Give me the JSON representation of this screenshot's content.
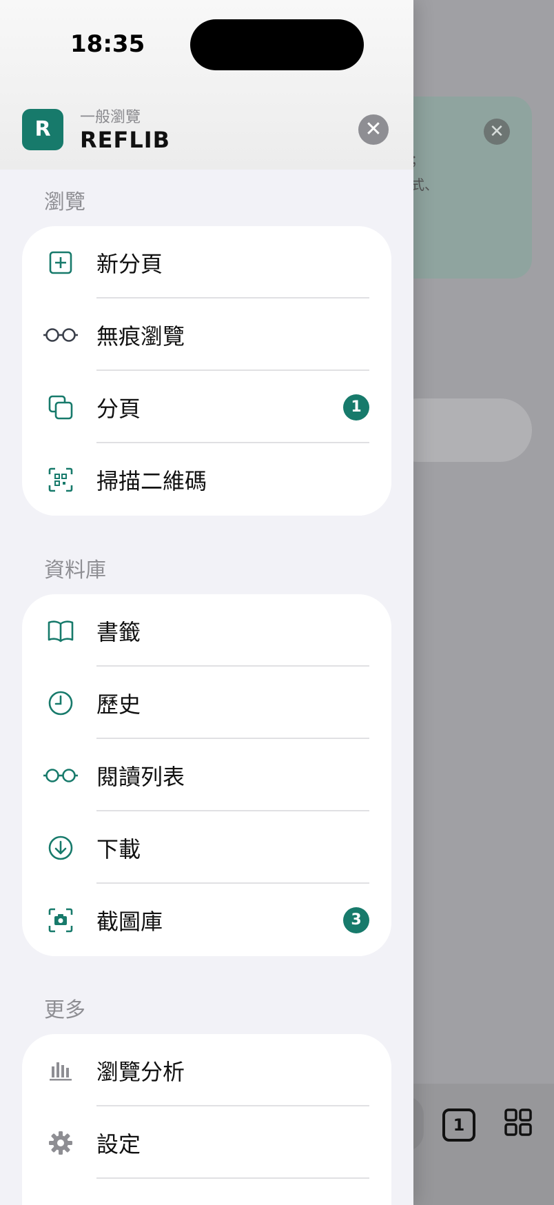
{
  "status_bar": {
    "time": "18:35"
  },
  "header": {
    "app_logo_letter": "R",
    "subtitle": "一般瀏覽",
    "title": "REFLIB",
    "close_icon": "close-icon"
  },
  "sections": [
    {
      "title": "瀏覽",
      "items": [
        {
          "label": "新分頁",
          "icon": "plus-square-icon"
        },
        {
          "label": "無痕瀏覽",
          "icon": "glasses-icon"
        },
        {
          "label": "分頁",
          "icon": "tabs-icon",
          "badge": "1"
        },
        {
          "label": "掃描二維碼",
          "icon": "qr-scan-icon"
        }
      ]
    },
    {
      "title": "資料庫",
      "items": [
        {
          "label": "書籤",
          "icon": "book-icon"
        },
        {
          "label": "歷史",
          "icon": "clock-icon"
        },
        {
          "label": "閱讀列表",
          "icon": "reading-glasses-icon"
        },
        {
          "label": "下載",
          "icon": "download-icon"
        },
        {
          "label": "截圖庫",
          "icon": "camera-icon",
          "badge": "3"
        }
      ]
    },
    {
      "title": "更多",
      "items": [
        {
          "label": "瀏覽分析",
          "icon": "bar-chart-icon"
        },
        {
          "label": "設定",
          "icon": "gear-icon"
        }
      ]
    }
  ],
  "background": {
    "card_text": "；\n式、",
    "tab_count": "1"
  },
  "colors": {
    "accent": "#177a6b",
    "drawer_bg": "#f2f2f7",
    "text": "#111111",
    "muted": "#8e8e93"
  }
}
